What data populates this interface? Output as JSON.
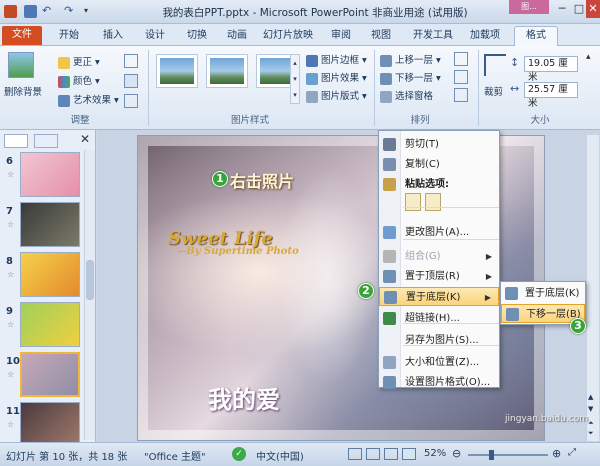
{
  "window": {
    "title": "我的表白PPT.pptx - Microsoft PowerPoint 非商业用途 (试用版)",
    "context_tab_group": "图...",
    "controls": [
      "─",
      "□",
      "✕"
    ]
  },
  "tabs": [
    "文件",
    "开始",
    "插入",
    "设计",
    "切换",
    "动画",
    "幻灯片放映",
    "审阅",
    "视图",
    "开发工具",
    "加载项",
    "格式"
  ],
  "ribbon": {
    "adjust": {
      "remove_bg": "删除背景",
      "corrections": "更正",
      "color": "颜色",
      "artistic_effects": "艺术效果",
      "group_label": "调整"
    },
    "picture_styles": {
      "border": "图片边框",
      "effects": "图片效果",
      "layout": "图片版式",
      "group_label": "图片样式"
    },
    "arrange": {
      "bring_forward": "上移一层",
      "send_backward": "下移一层",
      "selection_pane": "选择窗格",
      "group_label": "排列"
    },
    "crop": "裁剪",
    "size": {
      "height": "19.05 厘米",
      "width": "25.57 厘米",
      "group_label": "大小"
    }
  },
  "slides": [
    {
      "num": "6",
      "colors": [
        "#f1c6d3",
        "#e58fa8"
      ]
    },
    {
      "num": "7",
      "colors": [
        "#3a3a3a",
        "#7a7a6a"
      ]
    },
    {
      "num": "8",
      "colors": [
        "#f5d14a",
        "#e58a2c"
      ]
    },
    {
      "num": "9",
      "colors": [
        "#9fd05a",
        "#f0d040"
      ]
    },
    {
      "num": "10",
      "colors": [
        "#c7a8b8",
        "#8f8ea6"
      ]
    },
    {
      "num": "11",
      "colors": [
        "#4a3a40",
        "#a07a6a"
      ]
    }
  ],
  "slide_content": {
    "title_en": "Sweet Life",
    "subtitle_en": "--By Supertime Photo",
    "title_cn": "我的爱"
  },
  "annotations": {
    "step1": "右击照片",
    "step1_num": "1",
    "step2_num": "2",
    "step3_num": "3"
  },
  "context_menu": [
    {
      "label": "剪切(T)",
      "icon": "scissors-icon",
      "color": "#6b7b95"
    },
    {
      "label": "复制(C)",
      "icon": "copy-icon",
      "color": "#7a8fb0"
    },
    {
      "label": "粘贴选项:",
      "icon": "paste-icon",
      "color": "#c7a04a",
      "bold": true
    },
    {
      "label": "",
      "icon": "paste-options",
      "color": ""
    },
    {
      "label": "更改图片(A)...",
      "icon": "change-picture-icon",
      "color": "#6f9bd0"
    },
    {
      "label": "组合(G)",
      "icon": "group-icon",
      "color": "#b5b5b5",
      "disabled": true,
      "arrow": true
    },
    {
      "label": "置于顶层(R)",
      "icon": "bring-front-icon",
      "color": "#6f8fb5",
      "arrow": true
    },
    {
      "label": "置于底层(K)",
      "icon": "send-back-icon",
      "color": "#6f8fb5",
      "arrow": true,
      "highlight": true
    },
    {
      "label": "超链接(H)...",
      "icon": "hyperlink-icon",
      "color": "#3e8a4a"
    },
    {
      "label": "另存为图片(S)...",
      "icon": "save-as-picture-icon",
      "color": ""
    },
    {
      "label": "大小和位置(Z)...",
      "icon": "size-position-icon",
      "color": "#8fa5c2"
    },
    {
      "label": "设置图片格式(O)...",
      "icon": "format-picture-icon",
      "color": "#6f8fb5"
    }
  ],
  "submenu": [
    {
      "label": "置于底层(K)",
      "icon": "send-to-back-icon"
    },
    {
      "label": "下移一层(B)",
      "icon": "send-backward-icon",
      "highlight": true
    }
  ],
  "statusbar": {
    "slide_info": "幻灯片 第 10 张，共 18 张",
    "theme": "\"Office 主题\"",
    "language": "中文(中国)",
    "zoom": "52%"
  },
  "watermark": "jingyan.baidu.com"
}
